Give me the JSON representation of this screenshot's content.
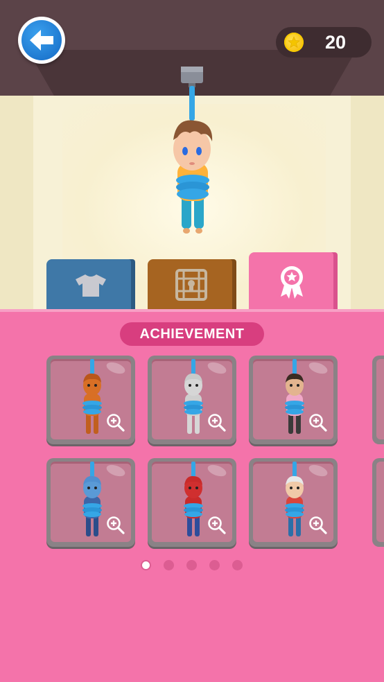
{
  "header": {
    "back_icon": "back-arrow-icon",
    "coins": {
      "icon": "star-coin-icon",
      "count": "20"
    }
  },
  "tabs": [
    {
      "name": "clothes",
      "icon": "shirt-icon",
      "active": false,
      "color": "#3f78a7"
    },
    {
      "name": "rooms",
      "icon": "cage-icon",
      "active": false,
      "color": "#a66421"
    },
    {
      "name": "achievement",
      "icon": "ribbon-badge-icon",
      "active": true,
      "color": "#f473aa"
    }
  ],
  "panel": {
    "title": "ACHIEVEMENT",
    "cards": [
      {
        "character": "orange-hood-character",
        "hair": "#b9561b",
        "skin": "#d86f25",
        "shirt": "#d86f25",
        "pants": "#c15f1e",
        "action_icon": "zoom-in-icon"
      },
      {
        "character": "dog-character",
        "hair": "#c9c9c9",
        "skin": "#d6d6d6",
        "shirt": "#cfcfcf",
        "pants": "#d6d6d6",
        "action_icon": "zoom-in-icon"
      },
      {
        "character": "monkey-character",
        "hair": "#3a2b22",
        "skin": "#e3b48f",
        "shirt": "#f0a8c8",
        "pants": "#3a3a3a",
        "action_icon": "zoom-in-icon"
      },
      {
        "character": "blue-alien-character",
        "hair": "#4f8fd0",
        "skin": "#5a9ad6",
        "shirt": "#3c66a8",
        "pants": "#2c4d8a",
        "action_icon": "zoom-in-icon"
      },
      {
        "character": "red-mask-character",
        "hair": "#c92a2a",
        "skin": "#d02f2f",
        "shirt": "#c92a2a",
        "pants": "#2d4d9b",
        "action_icon": "zoom-in-icon"
      },
      {
        "character": "old-man-glasses-character",
        "hair": "#e8e8e8",
        "skin": "#f0c9a8",
        "shirt": "#d9443b",
        "pants": "#2c6fa8",
        "action_icon": "zoom-in-icon"
      }
    ]
  },
  "pager": {
    "pages": 5,
    "current": 1
  },
  "colors": {
    "panel": "#f473aa",
    "title_pill": "#d83e7f",
    "back_button": "#1f7fd6",
    "rope": "#35a6e6"
  }
}
